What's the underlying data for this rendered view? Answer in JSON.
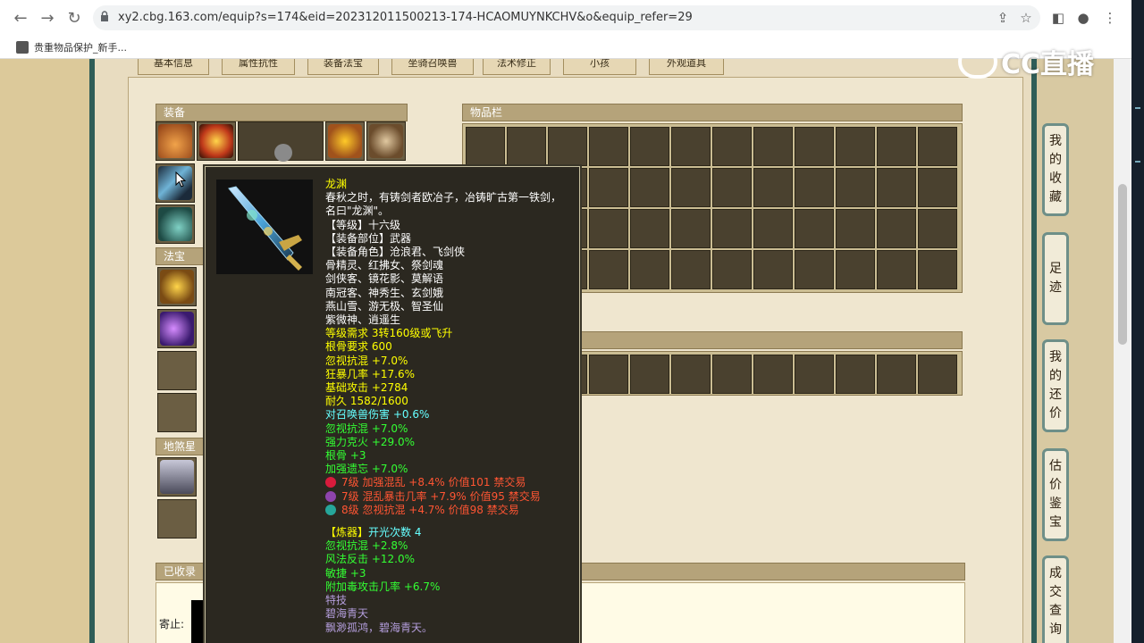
{
  "browser": {
    "url": "xy2.cbg.163.com/equip?s=174&eid=202312011500213-174-HCAOMUYNKCHV&o&equip_refer=29",
    "bookmark_label": "贵重物品保护_新手..."
  },
  "watermark": "CC直播",
  "tabs": [
    "基本信息",
    "属性抗性",
    "装备法宝",
    "坐骑召唤兽",
    "法术修正",
    "小孩",
    "外观道具"
  ],
  "sections": {
    "equip": "装备",
    "fabao": "法宝",
    "dishashixing": "地煞星",
    "items": "物品栏",
    "collected": "已收录",
    "mount_label": "寄止:"
  },
  "right_nav": [
    {
      "label": "我的收藏",
      "chars": [
        "我",
        "的",
        "收",
        "藏"
      ]
    },
    {
      "label": "足迹",
      "chars": [
        "足",
        "迹"
      ]
    },
    {
      "label": "我的还价",
      "chars": [
        "我",
        "的",
        "还",
        "价"
      ]
    },
    {
      "label": "估价鉴宝",
      "chars": [
        "估",
        "价",
        "鉴",
        "宝"
      ]
    },
    {
      "label": "成交查询",
      "chars": [
        "成",
        "交",
        "查",
        "询"
      ]
    }
  ],
  "tooltip": {
    "name": "龙渊",
    "desc1": "春秋之时，有铸剑者欧冶子，冶铸旷古第一铁剑，",
    "desc2": "名曰\"龙渊\"。",
    "level": "【等级】十六级",
    "part": "【装备部位】武器",
    "roles": [
      "【装备角色】沧浪君、飞剑侠",
      "骨精灵、红拂女、祭剑魂",
      "剑侠客、镜花影、莫解语",
      "南冠客、神秀生、玄剑娥",
      "燕山雪、游无极、智圣仙",
      "紫微神、逍遥生"
    ],
    "req_level": "等级需求 3转160级或飞升",
    "req_gengu": "根骨要求 600",
    "base_attrs": [
      "忽视抗混 +7.0%",
      "狂暴几率 +17.6%",
      "基础攻击 +2784"
    ],
    "durability": "耐久 1582/1600",
    "extra_attrs": [
      {
        "text": "对召唤兽伤害 +0.6%",
        "color": "cyan"
      },
      {
        "text": "忽视抗混 +7.0%",
        "color": "green"
      },
      {
        "text": "强力克火 +29.0%",
        "color": "green"
      },
      {
        "text": "根骨 +3",
        "color": "green"
      },
      {
        "text": "加强遗忘 +7.0%",
        "color": "green"
      }
    ],
    "gems": [
      {
        "text": "7级 加强混乱 +8.4% 价值101 禁交易",
        "color": "#d81b3c"
      },
      {
        "text": "7级 混乱暴击几率 +7.9% 价值95 禁交易",
        "color": "#8e44ad"
      },
      {
        "text": "8级 忽视抗混 +4.7% 价值98 禁交易",
        "color": "#26a69a"
      }
    ],
    "refine_label": "【炼器】",
    "refine_count": "开光次数 4",
    "refine_attrs": [
      "忽视抗混 +2.8%",
      "风法反击 +12.0%",
      "敏捷 +3",
      "附加毒攻击几率 +6.7%"
    ],
    "special_label": "特技",
    "special_1": "碧海青天",
    "special_2": "飘渺孤鸿，碧海青天。"
  }
}
